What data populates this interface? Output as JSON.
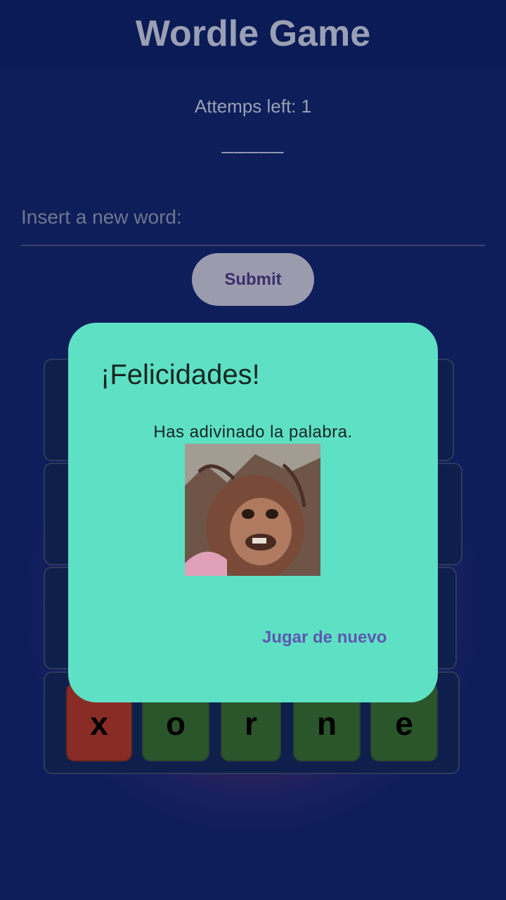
{
  "app": {
    "title": "Wordle Game"
  },
  "status": {
    "attempts_label": "Attemps left: 1",
    "word_dashes": "_____"
  },
  "input": {
    "placeholder": "Insert a new word:",
    "value": ""
  },
  "buttons": {
    "submit_label": "Submit"
  },
  "board": {
    "last_row": {
      "letters": [
        "x",
        "o",
        "r",
        "n",
        "e"
      ],
      "states": [
        "absent",
        "correct",
        "correct",
        "correct",
        "correct"
      ]
    }
  },
  "dialog": {
    "title": "¡Felicidades!",
    "message": "Has adivinado la palabra.",
    "image": "orangutan-reaction-image",
    "action_label": "Jugar de nuevo"
  },
  "colors": {
    "background": "#0e1e5a",
    "dialog": "#5ee0c4",
    "absent": "#882c25",
    "correct": "#2b562b",
    "action": "#5e57b0"
  }
}
